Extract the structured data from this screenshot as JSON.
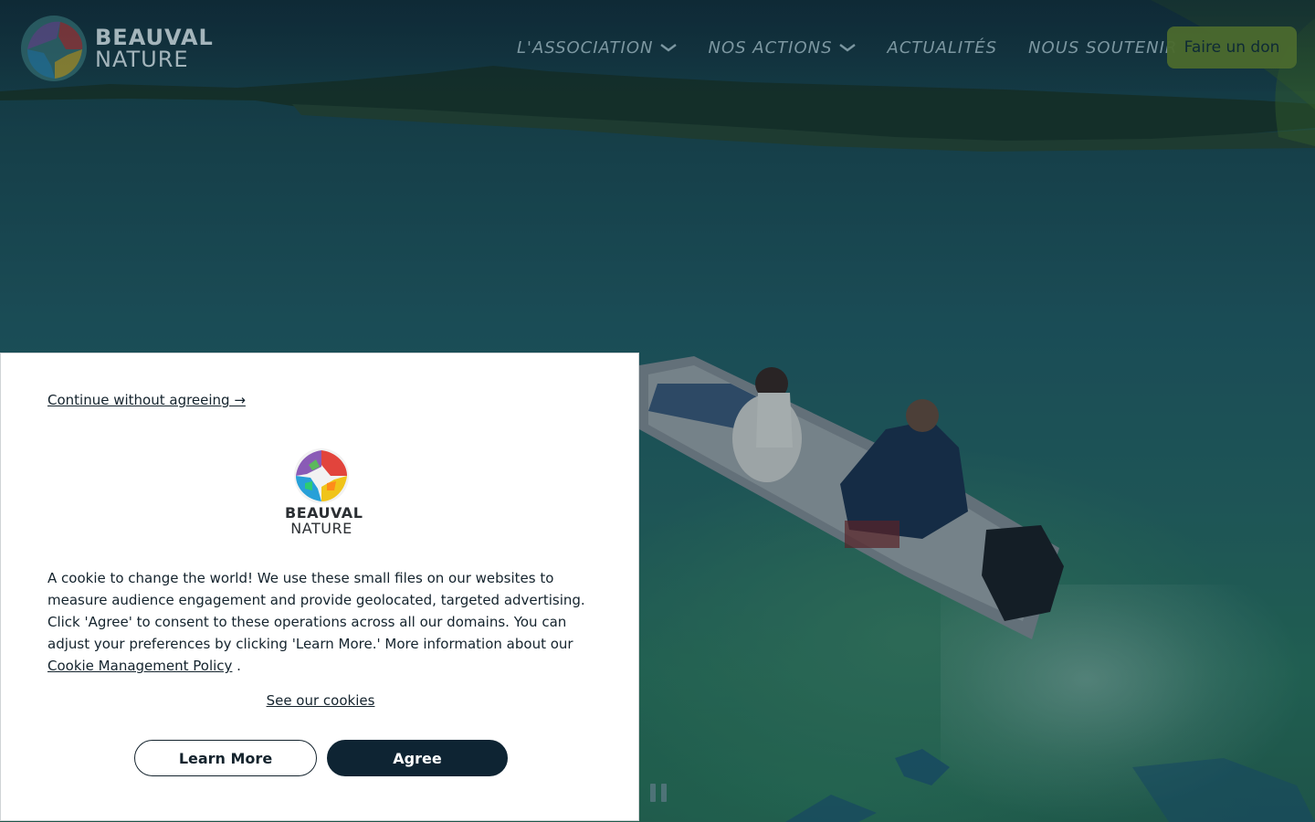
{
  "header": {
    "logo": {
      "line1": "BEAUVAL",
      "line2": "NATURE"
    },
    "nav": [
      {
        "label": "L'ASSOCIATION",
        "has_dropdown": true
      },
      {
        "label": "NOS ACTIONS",
        "has_dropdown": true
      },
      {
        "label": "ACTUALITÉS",
        "has_dropdown": false
      },
      {
        "label": "NOUS SOUTENIR",
        "has_dropdown": false
      }
    ],
    "donate_label": "Faire un don"
  },
  "hero": {
    "pause_icon": "pause-icon"
  },
  "cookie": {
    "continue_label": "Continue without agreeing →",
    "logo": {
      "line1": "BEAUVAL",
      "line2": "NATURE"
    },
    "text": "A cookie to change the world! We use these small files on our websites to measure audience engagement and provide geolocated, targeted advertising. Click 'Agree' to consent to these operations across all our domains. You can adjust your preferences by clicking 'Learn More.' More information about our",
    "policy_link": "Cookie Management Policy",
    "text_end": " .",
    "see_cookies": "See our cookies",
    "learn_more": "Learn More",
    "agree": "Agree"
  },
  "colors": {
    "dark_navy": "#0e2433",
    "donate_bg": "#4b6a2e",
    "water": "#25626a"
  }
}
